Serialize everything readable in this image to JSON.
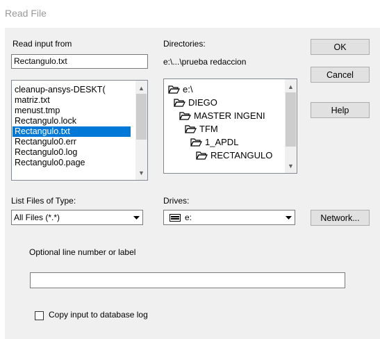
{
  "window": {
    "title": "Read File"
  },
  "read_input": {
    "label": "Read input from",
    "value": "Rectangulo.txt",
    "files": [
      "cleanup-ansys-DESKT(",
      "matriz.txt",
      "menust.tmp",
      "Rectangulo.lock",
      "Rectangulo.txt",
      "Rectangulo0.err",
      "Rectangulo0.log",
      "Rectangulo0.page"
    ],
    "selected_file": "Rectangulo.txt"
  },
  "directories": {
    "label": "Directories:",
    "current_path": "e:\\...\\prueba redaccion",
    "items": [
      "e:\\",
      "DIEGO",
      "MASTER INGENI",
      "TFM",
      "1_APDL",
      "RECTANGULO"
    ]
  },
  "buttons": {
    "ok": "OK",
    "cancel": "Cancel",
    "help": "Help",
    "network": "Network..."
  },
  "file_type": {
    "label": "List Files of Type:",
    "value": "All Files (*.*)"
  },
  "drives": {
    "label": "Drives:",
    "value": "e:"
  },
  "optional": {
    "label": "Optional line number or label",
    "value": ""
  },
  "copy_log": {
    "label": "Copy input to database log",
    "checked": false
  }
}
